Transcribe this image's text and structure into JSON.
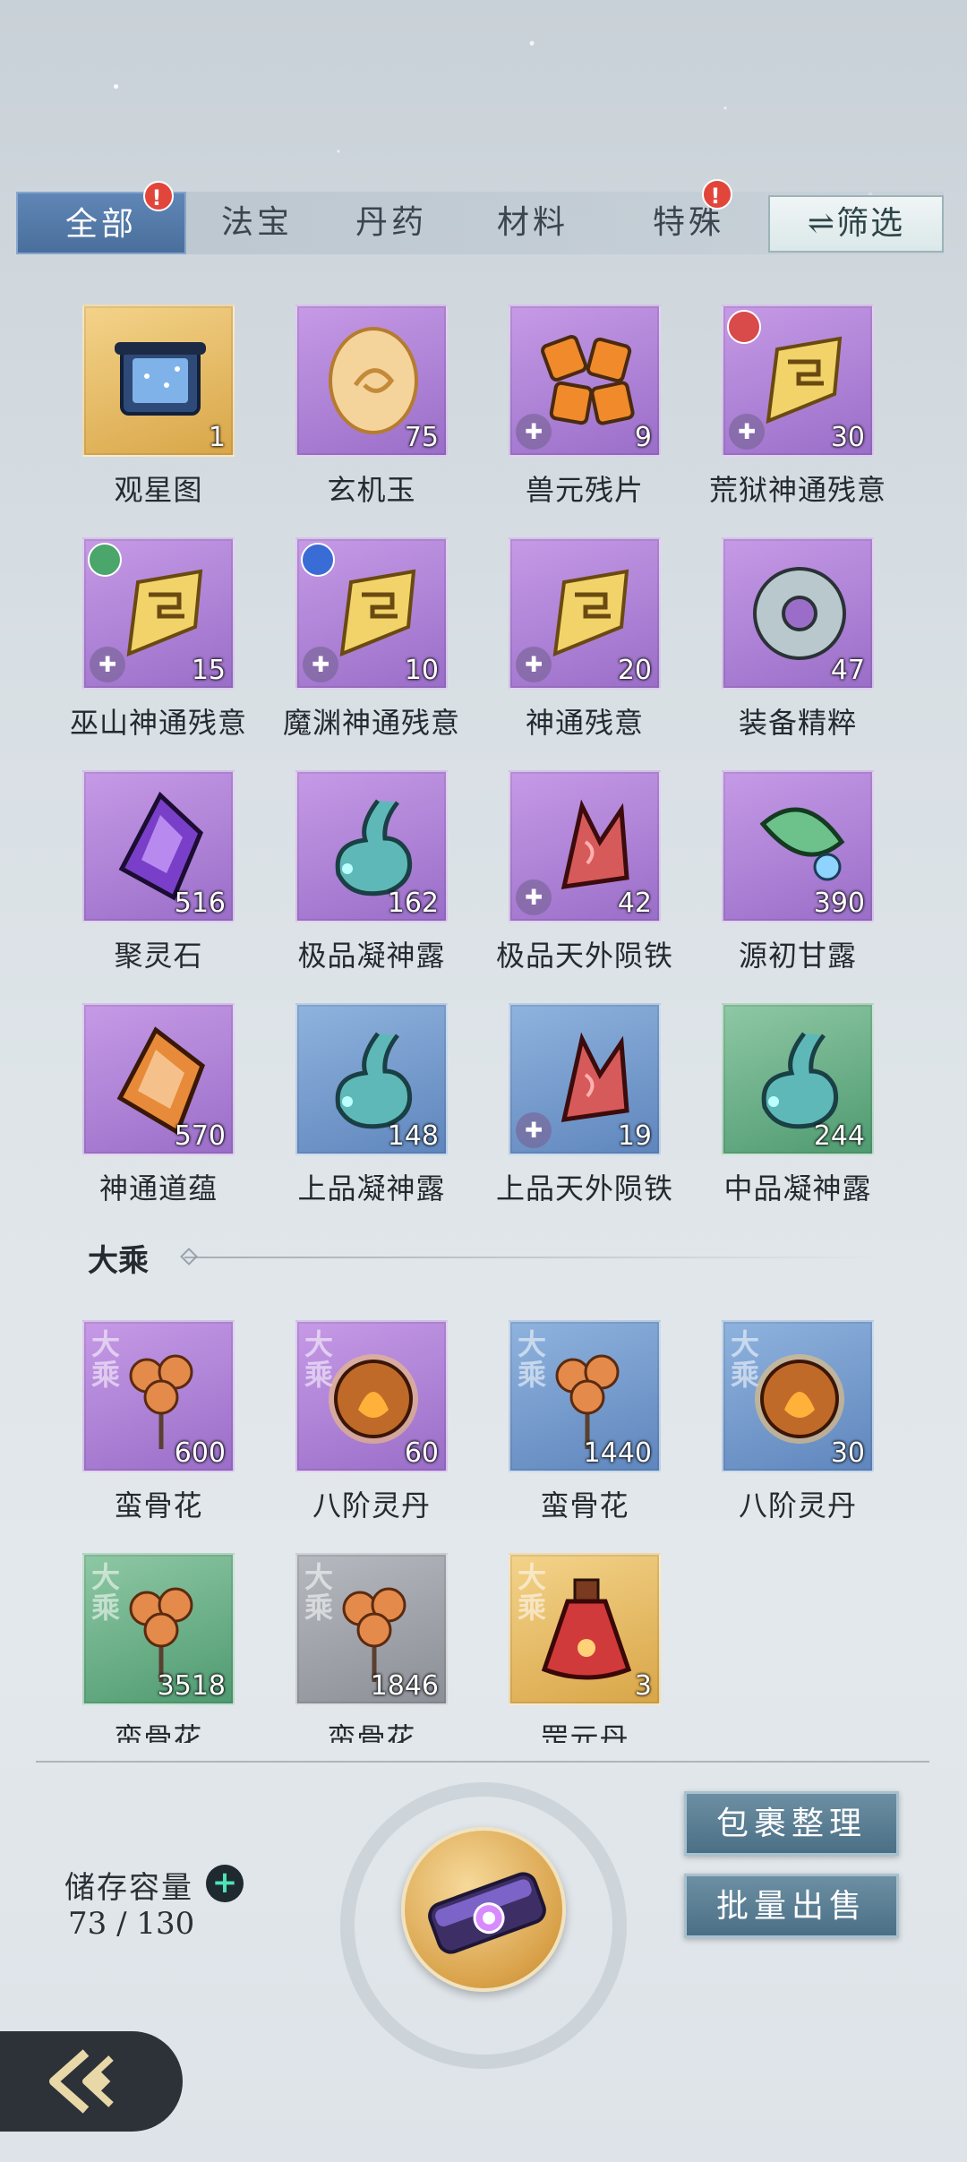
{
  "tabs": [
    {
      "label": "全部",
      "active": true,
      "alert": "!"
    },
    {
      "label": "法宝",
      "active": false
    },
    {
      "label": "丹药",
      "active": false
    },
    {
      "label": "材料",
      "active": false
    },
    {
      "label": "特殊",
      "active": false,
      "alert": "!"
    }
  ],
  "filter_label": "⇌筛选",
  "items_row1": [
    {
      "name": "观星图",
      "count": "1",
      "rarity": "gold",
      "icon": "star-chart-scroll-icon"
    },
    {
      "name": "玄机玉",
      "count": "75",
      "rarity": "purple",
      "icon": "jade-icon"
    },
    {
      "name": "兽元残片",
      "count": "9",
      "rarity": "purple",
      "icon": "beast-shards-icon",
      "puzzle": true
    },
    {
      "name": "荒狱神通残意",
      "count": "30",
      "rarity": "purple",
      "icon": "golden-fragment-icon",
      "puzzle": true,
      "sect": "red"
    }
  ],
  "items_row2": [
    {
      "name": "巫山神通残意",
      "count": "15",
      "rarity": "purple",
      "icon": "golden-fragment-icon",
      "puzzle": true,
      "sect": "green"
    },
    {
      "name": "魔渊神通残意",
      "count": "10",
      "rarity": "purple",
      "icon": "golden-fragment-icon",
      "puzzle": true,
      "sect": "blue"
    },
    {
      "name": "神通残意",
      "count": "20",
      "rarity": "purple",
      "icon": "golden-fragment-icon",
      "puzzle": true
    },
    {
      "name": "装备精粹",
      "count": "47",
      "rarity": "purple",
      "icon": "stone-ring-icon"
    }
  ],
  "items_row3": [
    {
      "name": "聚灵石",
      "count": "516",
      "rarity": "purple",
      "icon": "purple-crystal-icon"
    },
    {
      "name": "极品凝神露",
      "count": "162",
      "rarity": "purple",
      "icon": "dew-gourd-icon"
    },
    {
      "name": "极品天外陨铁",
      "count": "42",
      "rarity": "purple",
      "icon": "red-ore-icon",
      "puzzle": true
    },
    {
      "name": "源初甘露",
      "count": "390",
      "rarity": "purple",
      "icon": "leaf-dew-icon"
    }
  ],
  "items_row4": [
    {
      "name": "神通道蕴",
      "count": "570",
      "rarity": "purple",
      "icon": "amber-crystal-icon"
    },
    {
      "name": "上品凝神露",
      "count": "148",
      "rarity": "blue",
      "icon": "dew-gourd-icon"
    },
    {
      "name": "上品天外陨铁",
      "count": "19",
      "rarity": "blue",
      "icon": "red-ore-icon",
      "puzzle": true
    },
    {
      "name": "中品凝神露",
      "count": "244",
      "rarity": "green",
      "icon": "dew-gourd-icon"
    }
  ],
  "section_title": "大乘",
  "realm_mark": "大\n乘",
  "items_row5": [
    {
      "name": "蛮骨花",
      "count": "600",
      "rarity": "purple",
      "icon": "orange-flower-icon"
    },
    {
      "name": "八阶灵丹",
      "count": "60",
      "rarity": "purple",
      "icon": "fire-pill-icon"
    },
    {
      "name": "蛮骨花",
      "count": "1440",
      "rarity": "blue",
      "icon": "orange-flower-icon"
    },
    {
      "name": "八阶灵丹",
      "count": "30",
      "rarity": "blue",
      "icon": "fire-pill-icon"
    }
  ],
  "items_row6": [
    {
      "name": "蛮骨花",
      "count": "3518",
      "rarity": "green",
      "icon": "orange-flower-icon"
    },
    {
      "name": "蛮骨花",
      "count": "1846",
      "rarity": "gray",
      "icon": "orange-flower-icon"
    },
    {
      "name": "罡元丹",
      "count": "3",
      "rarity": "gold",
      "icon": "red-potion-icon"
    }
  ],
  "storage": {
    "label": "储存容量",
    "plus": "+",
    "value": "73 / 130"
  },
  "buttons": {
    "organize": "包裹整理",
    "batch_sell": "批量出售"
  },
  "puzzle_glyph": "✚",
  "colors": {
    "tab_active": "#4a6f9c",
    "alert": "#e2453a",
    "button": "#4b6f85"
  }
}
